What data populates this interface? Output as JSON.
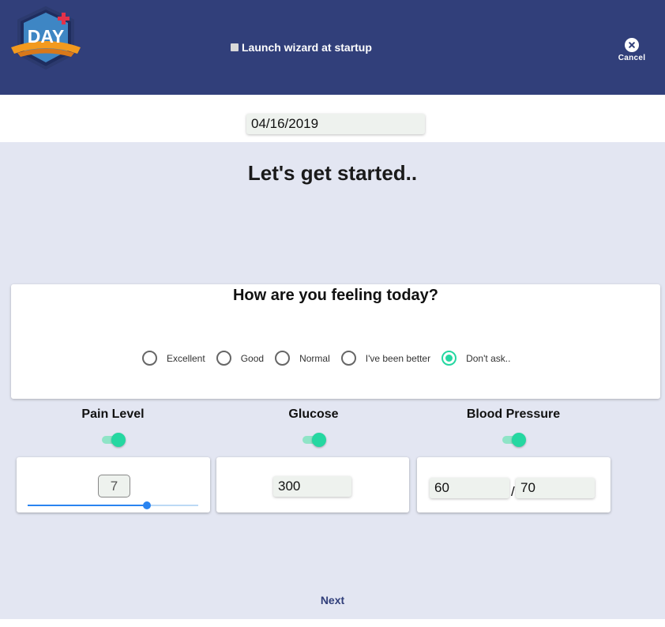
{
  "header": {
    "logo_text": "DAY",
    "wizard_label": "Launch wizard at startup",
    "wizard_checked": false,
    "cancel_label": "Cancel",
    "cancel_icon": "close-circle-icon",
    "colors": {
      "background": "#313f7a",
      "logo_orange": "#f39a1e",
      "logo_cross": "#e3324a"
    }
  },
  "date_field": {
    "value": "04/16/2019"
  },
  "main": {
    "title": "Let's get started..",
    "background": "#e3e6f2"
  },
  "feeling": {
    "question": "How are you feeling today?",
    "options": [
      "Excellent",
      "Good",
      "Normal",
      "I've been better",
      "Don't ask.."
    ],
    "selected": "Don't ask..",
    "accent": "#25d7a1"
  },
  "metrics": {
    "pain": {
      "title": "Pain Level",
      "enabled": true,
      "value": "7",
      "slider_fraction": 0.7
    },
    "glucose": {
      "title": "Glucose",
      "enabled": true,
      "value": "300"
    },
    "blood_pressure": {
      "title": "Blood Pressure",
      "enabled": true,
      "systolic": "60",
      "separator": "/",
      "diastolic": "70"
    }
  },
  "footer": {
    "next_label": "Next"
  }
}
